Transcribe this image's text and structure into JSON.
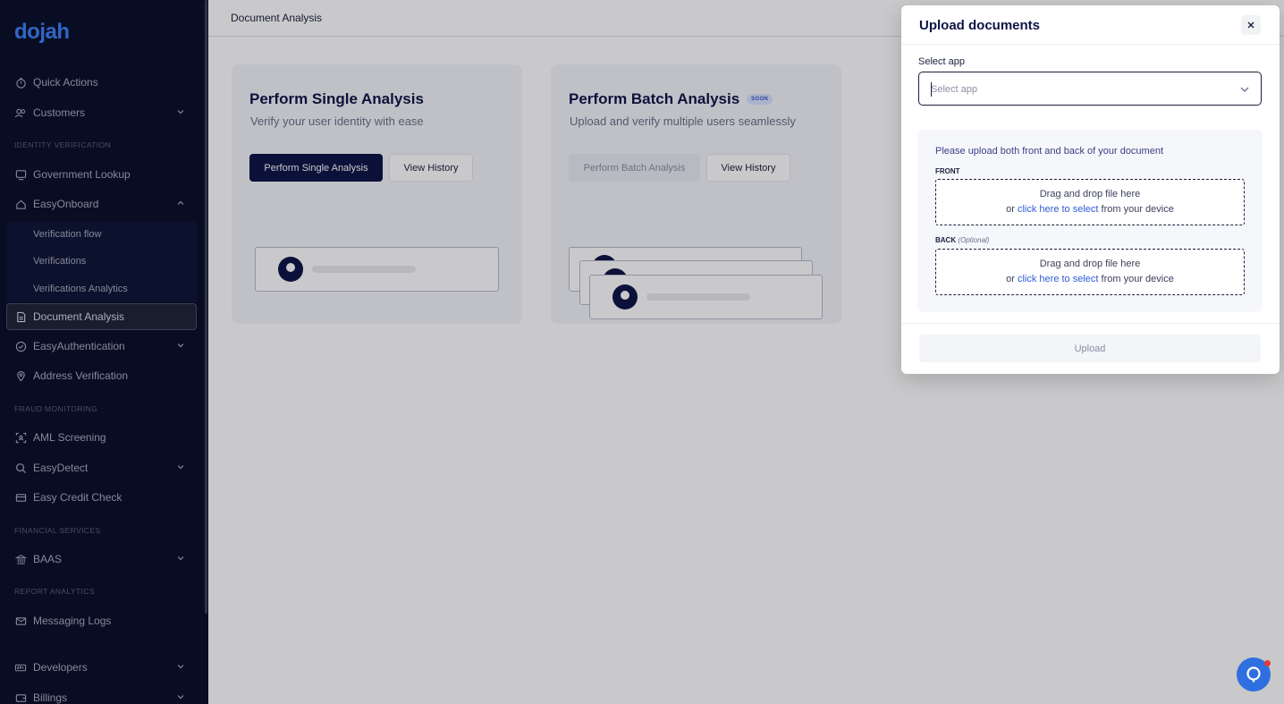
{
  "brand": {
    "logo_text": "dojah",
    "accent": "#3b82f6",
    "primary": "#0e1446"
  },
  "sidebar": {
    "items": {
      "quick_actions": "Quick Actions",
      "customers": "Customers",
      "government_lookup": "Government Lookup",
      "easyonboard": "EasyOnboard",
      "verification_flow": "Verification flow",
      "verifications": "Verifications",
      "verifications_analytics": "Verifications Analytics",
      "document_analysis": "Document Analysis",
      "easyauthentication": "EasyAuthentication",
      "address_verification": "Address Verification",
      "aml_screening": "AML Screening",
      "easydetect": "EasyDetect",
      "easy_credit_check": "Easy Credit Check",
      "baas": "BAAS",
      "messaging_logs": "Messaging Logs",
      "developers": "Developers",
      "billings": "Billings"
    },
    "sections": {
      "identity_verification": "IDENTITY VERIFICATION",
      "fraud_monitoring": "FRAUD MONITORING",
      "financial_services": "FINANCIAL SERVICES",
      "report_analytics": "REPORT ANALYTICS"
    }
  },
  "header": {
    "title": "Document Analysis"
  },
  "cards": {
    "single": {
      "title": "Perform Single Analysis",
      "subtitle": "Verify your user identity with ease",
      "primary_button": "Perform Single Analysis",
      "history_button": "View History"
    },
    "batch": {
      "title": "Perform Batch Analysis",
      "badge": "SOON",
      "subtitle": "Upload and verify multiple users seamlessly",
      "primary_button": "Perform Batch Analysis",
      "history_button": "View History"
    }
  },
  "modal": {
    "title": "Upload documents",
    "select_label": "Select app",
    "select_placeholder": "Select app",
    "upload_note": "Please upload both front and back of your document",
    "front_label": "FRONT",
    "back_label": "BACK",
    "back_optional": "(Optional)",
    "dropzone_line1": "Drag and drop file here",
    "dropzone_prefix": "or",
    "dropzone_link": "click here to select",
    "dropzone_suffix": "from your device",
    "upload_button": "Upload"
  },
  "icons": {
    "close": "close-icon",
    "chevron": "chevron-down-icon",
    "chat": "chat-support-icon"
  }
}
